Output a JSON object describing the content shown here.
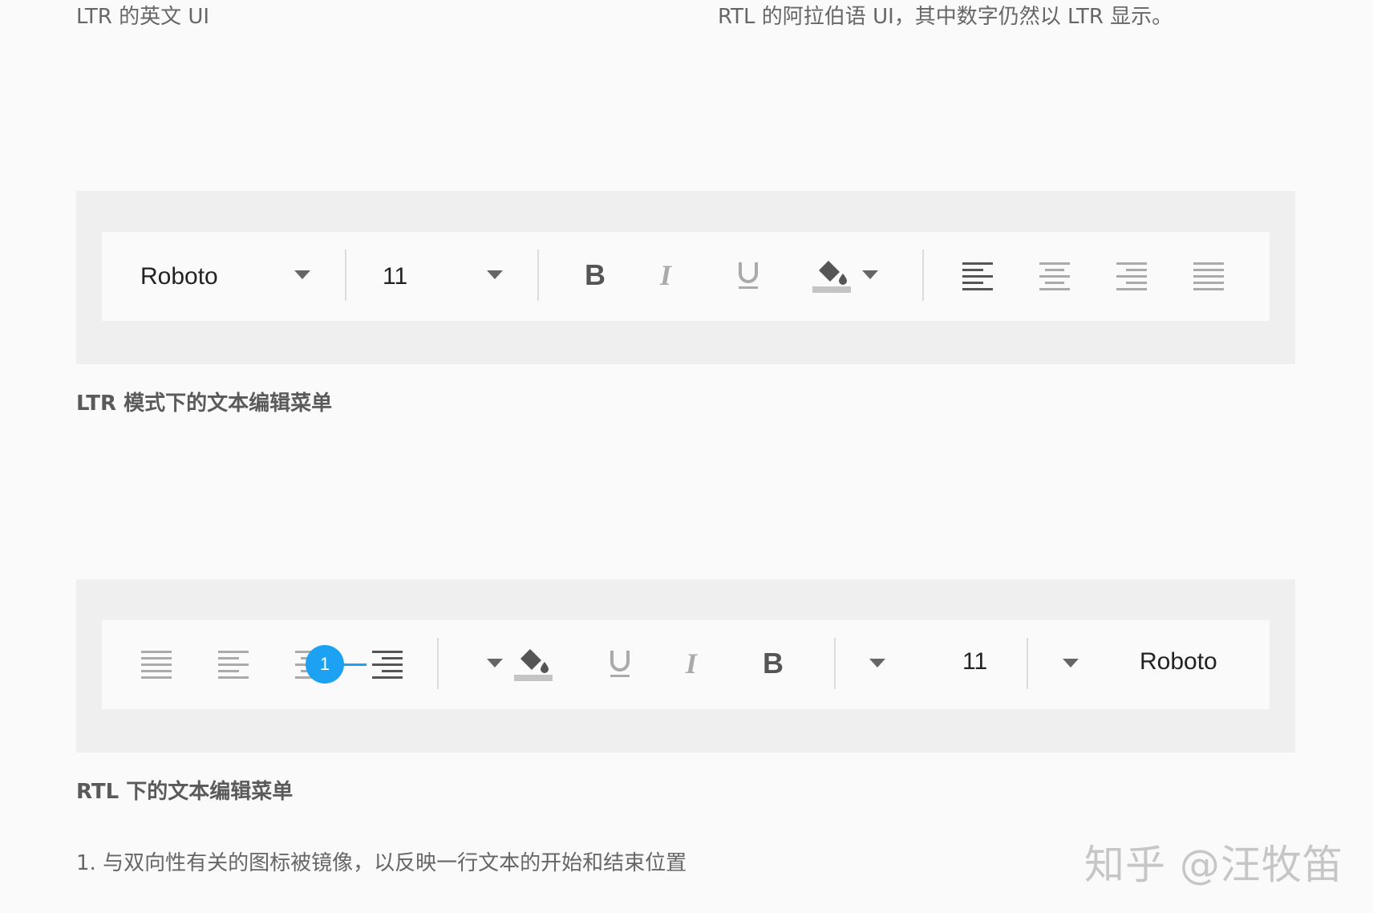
{
  "captions": {
    "ltr_header": "LTR 的英文 UI",
    "rtl_header": "RTL 的阿拉伯语 UI，其中数字仍然以 LTR 显示。",
    "ltr_label": "LTR 模式下的文本编辑菜单",
    "rtl_label": "RTL 下的文本编辑菜单",
    "note": "1. 与双向性有关的图标被镜像，以反映一行文本的开始和结束位置"
  },
  "ltr_toolbar": {
    "font_name": "Roboto",
    "font_size": "11",
    "icons": [
      "dropdown-arrow-icon",
      "bold-icon",
      "italic-icon",
      "underline-icon",
      "fill-color-icon",
      "align-left-icon",
      "align-center-icon",
      "align-right-icon",
      "justify-icon"
    ]
  },
  "rtl_toolbar": {
    "font_name": "Roboto",
    "font_size": "11",
    "icons": [
      "justify-icon",
      "align-left-icon",
      "align-center-icon",
      "align-right-icon",
      "fill-color-icon",
      "underline-icon",
      "italic-icon",
      "bold-icon",
      "dropdown-arrow-icon"
    ]
  },
  "callout": {
    "number": "1",
    "color": "#1da1f2"
  },
  "watermark": "知乎 @汪牧笛",
  "colors": {
    "icon_active": "#555555",
    "icon_inactive": "#aaaaaa",
    "panel_bg": "#efefef",
    "bar_bg": "#fafafa"
  }
}
